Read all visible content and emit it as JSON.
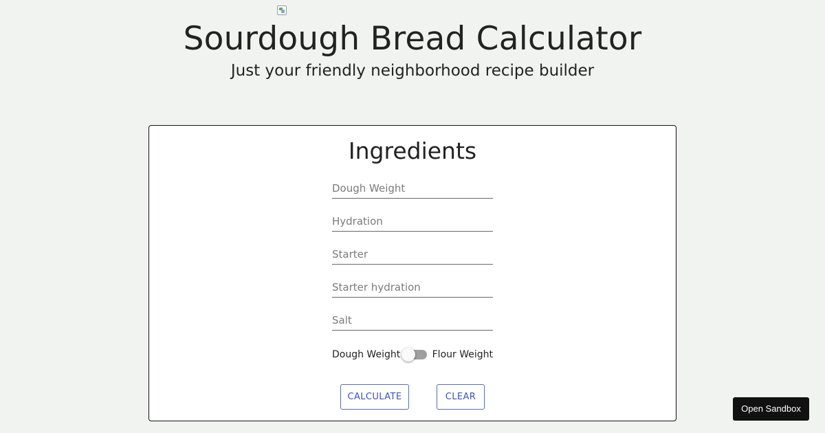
{
  "header": {
    "logo_icon": "broken-image-icon",
    "title": "Sourdough Bread Calculator",
    "subtitle": "Just your friendly neighborhood recipe builder"
  },
  "card": {
    "heading": "Ingredients",
    "fields": [
      {
        "placeholder": "Dough Weight",
        "value": ""
      },
      {
        "placeholder": "Hydration",
        "value": ""
      },
      {
        "placeholder": "Starter",
        "value": ""
      },
      {
        "placeholder": "Starter hydration",
        "value": ""
      },
      {
        "placeholder": "Salt",
        "value": ""
      }
    ],
    "toggle": {
      "left_label": "Dough Weight",
      "right_label": "Flour Weight",
      "checked": false
    },
    "buttons": {
      "calculate": "CALCULATE",
      "clear": "CLEAR"
    }
  },
  "sandbox_button": "Open Sandbox",
  "colors": {
    "page_background": "#f1f3f1",
    "button_text": "#3f51b5",
    "sandbox_background": "#111111"
  }
}
